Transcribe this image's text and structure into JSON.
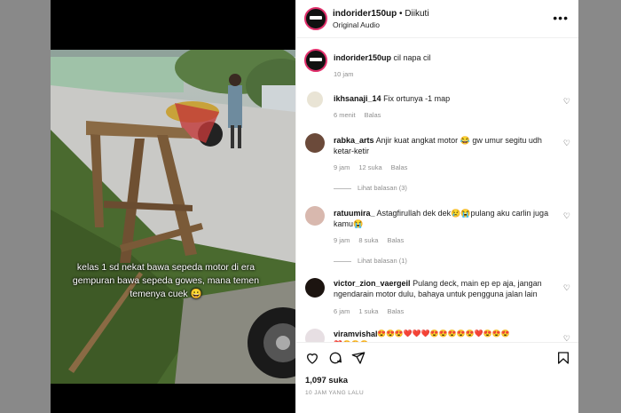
{
  "post": {
    "username": "indorider150up",
    "separator": " • ",
    "follow_status": "Diikuti",
    "audio": "Original Audio",
    "more_label": "•••"
  },
  "caption": {
    "username": "indorider150up",
    "text": "cil napa cil",
    "time": "10 jam"
  },
  "video_overlay_text": "kelas 1 sd nekat bawa sepeda motor di era gempuran bawa sepeda gowes, mana temen temenya cuek 😀",
  "comments": [
    {
      "user": "ikhsanaji_14",
      "text": "Fix ortunya -1 map",
      "time": "6 menit",
      "likes": "",
      "reply": "Balas",
      "view_replies": ""
    },
    {
      "user": "rabka_arts",
      "text": "Anjir kuat angkat motor 😂 gw umur segitu udh ketar-ketir",
      "time": "9 jam",
      "likes": "12 suka",
      "reply": "Balas",
      "view_replies": "Lihat balasan (3)"
    },
    {
      "user": "ratuumira_",
      "text": "Astagfirullah dek dek😢😭pulang aku carlin juga kamu😭",
      "time": "9 jam",
      "likes": "8 suka",
      "reply": "Balas",
      "view_replies": "Lihat balasan (1)"
    },
    {
      "user": "victor_zion_vaergeil",
      "text": "Pulang deck, main ep ep aja, jangan ngendarain motor dulu, bahaya untuk pengguna jalan lain",
      "time": "6 jam",
      "likes": "1 suka",
      "reply": "Balas",
      "view_replies": ""
    },
    {
      "user": "viramvishal",
      "text": "😍😍😍❤️❤️❤️😍😍😍😍😍❤️😍😍😍",
      "time": "",
      "likes": "",
      "reply": "",
      "view_replies": ""
    }
  ],
  "comment_emoji_line2": "❤️😍😍😍",
  "stats": {
    "likes": "1,097 suka",
    "timestamp": "10 JAM YANG LALU"
  },
  "icons": [
    "heart-icon",
    "comment-icon",
    "share-icon",
    "bookmark-icon",
    "more-icon"
  ]
}
